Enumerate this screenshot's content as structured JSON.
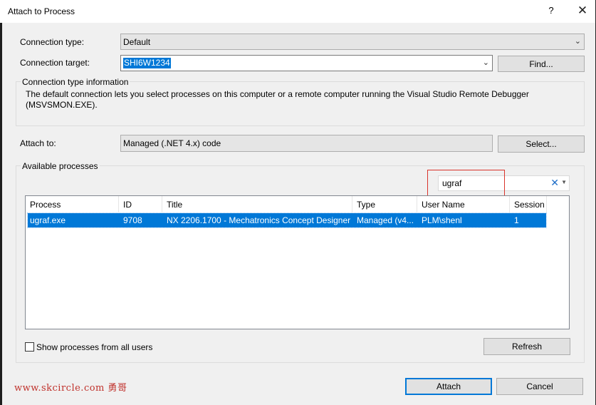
{
  "window": {
    "title": "Attach to Process",
    "help_label": "?",
    "close_label": "✕"
  },
  "connection": {
    "type_label": "Connection type:",
    "type_value": "Default",
    "target_label": "Connection target:",
    "target_value": "SHI6W1234",
    "find_button": "Find...",
    "info_title": "Connection type information",
    "info_text_1": "The default connection lets you select processes on this computer or a remote computer running the Visual Studio Remote Debugger",
    "info_text_2": "(MSVSMON.EXE)."
  },
  "attach_to": {
    "label": "Attach to:",
    "value": "Managed (.NET 4.x) code",
    "select_button": "Select..."
  },
  "available": {
    "group_title": "Available processes",
    "filter_value": "ugraf",
    "columns": [
      "Process",
      "ID",
      "Title",
      "Type",
      "User Name",
      "Session"
    ],
    "rows": [
      {
        "process": "ugraf.exe",
        "id": "9708",
        "title": "NX 2206.1700 - Mechatronics Concept Designer",
        "type": "Managed (v4...",
        "user": "PLM\\shenl",
        "session": "1"
      }
    ],
    "show_all_label": "Show processes from all users",
    "show_all_checked": false,
    "refresh_button": "Refresh"
  },
  "footer": {
    "attach_button": "Attach",
    "cancel_button": "Cancel"
  },
  "watermark": "www.skcircle.com 勇哥",
  "colors": {
    "selection": "#0078d7",
    "highlight": "#d9342b",
    "watermark": "#c0322c"
  }
}
